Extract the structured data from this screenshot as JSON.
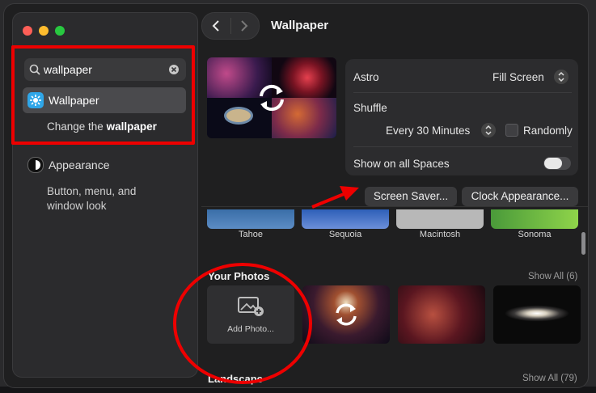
{
  "sidebar": {
    "search_value": "wallpaper",
    "items": [
      {
        "label": "Wallpaper",
        "sub_prefix": "Change the ",
        "sub_bold": "wallpaper"
      },
      {
        "label": "Appearance",
        "sub_line1": "Button, menu, and",
        "sub_line2": "window look"
      }
    ]
  },
  "header": {
    "title": "Wallpaper"
  },
  "settings": {
    "wallpaper_name": "Astro",
    "fill_mode": "Fill Screen",
    "shuffle_label": "Shuffle",
    "shuffle_interval": "Every 30 Minutes",
    "randomly_label": "Randomly",
    "show_on_spaces_label": "Show on all Spaces"
  },
  "buttons": {
    "screen_saver": "Screen Saver...",
    "clock_appearance": "Clock Appearance..."
  },
  "wallpapers": [
    "Tahoe",
    "Sequoia",
    "Macintosh",
    "Sonoma"
  ],
  "your_photos": {
    "title": "Your Photos",
    "show_all": "Show All (6)",
    "add_photo": "Add Photo..."
  },
  "landscape": {
    "title": "Landscape",
    "show_all": "Show All (79)"
  },
  "colors": {
    "accent": "#0a84ff",
    "annotation": "#e00000"
  }
}
